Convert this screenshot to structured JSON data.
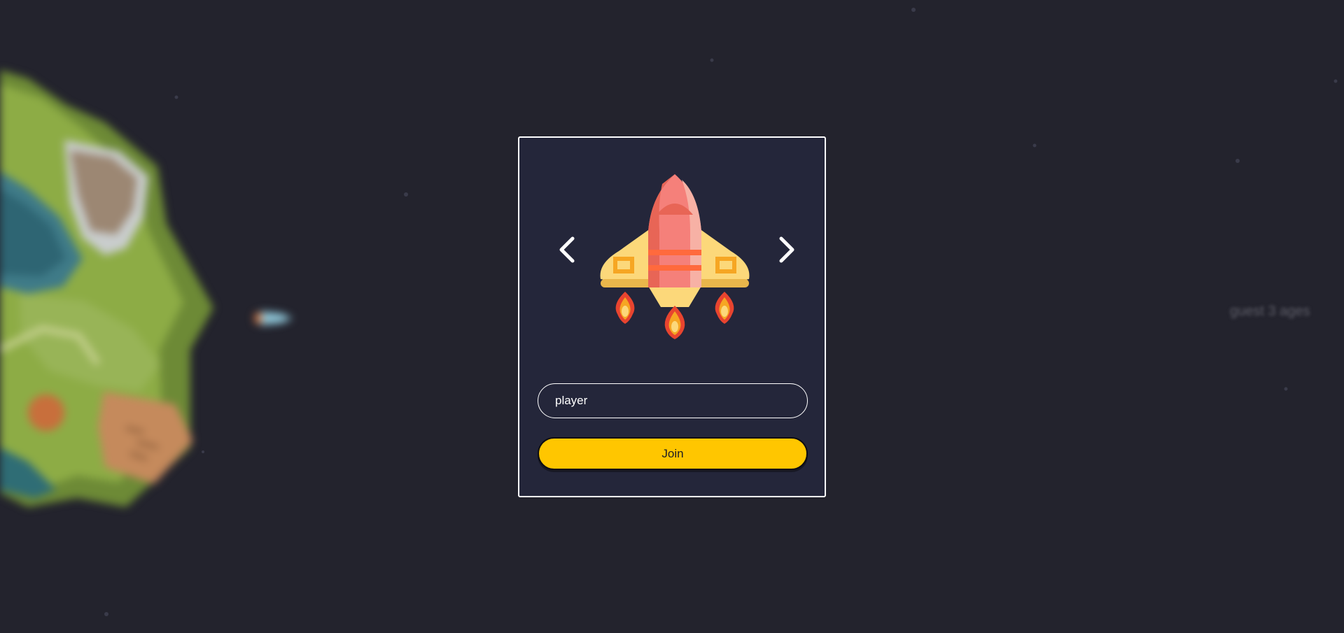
{
  "background": {
    "color": "#23232d",
    "other_player_label": "guest 3 ages",
    "planet_icon": "planet-island-icon",
    "other_ship_icon": "small-ship-icon"
  },
  "join_panel": {
    "prev_icon": "chevron-left-icon",
    "next_icon": "chevron-right-icon",
    "ship_icon": "rocket-ship-icon",
    "name_input": {
      "value": "player",
      "placeholder": ""
    },
    "join_label": "Join",
    "accent_color": "#ffc600",
    "border_color": "#ffffff"
  }
}
